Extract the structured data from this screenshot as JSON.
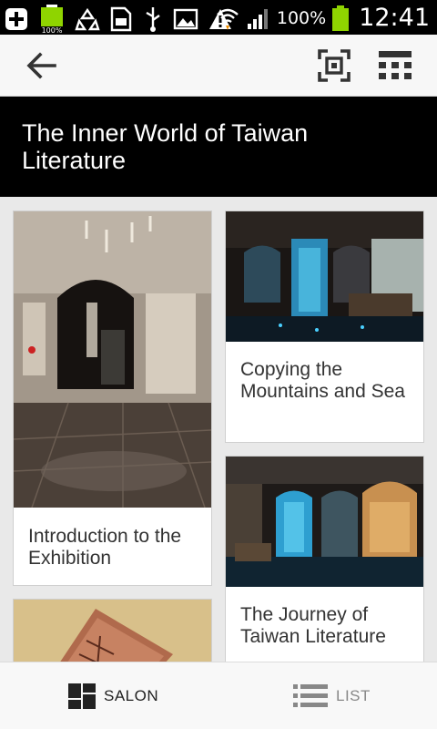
{
  "status_bar": {
    "battery_small_label": "100%",
    "battery_percent": "100%",
    "time": "12:41"
  },
  "app_bar": {
    "back_icon": "arrow-left-icon",
    "scan_icon": "qr-scan-icon",
    "grid_icon": "grid-menu-icon"
  },
  "header": {
    "title": "The Inner World of Taiwan Literature"
  },
  "cards": [
    {
      "label": "Introduction to the Exhibition"
    },
    {
      "label": "Copying the Mountains and Sea"
    },
    {
      "label": "The Journey of Taiwan Literature"
    }
  ],
  "tabs": {
    "salon": "SALON",
    "list": "LIST"
  },
  "colors": {
    "header_bg": "#000000",
    "active_tab": "#222222",
    "inactive_tab": "#888888",
    "battery": "#8fd400"
  }
}
